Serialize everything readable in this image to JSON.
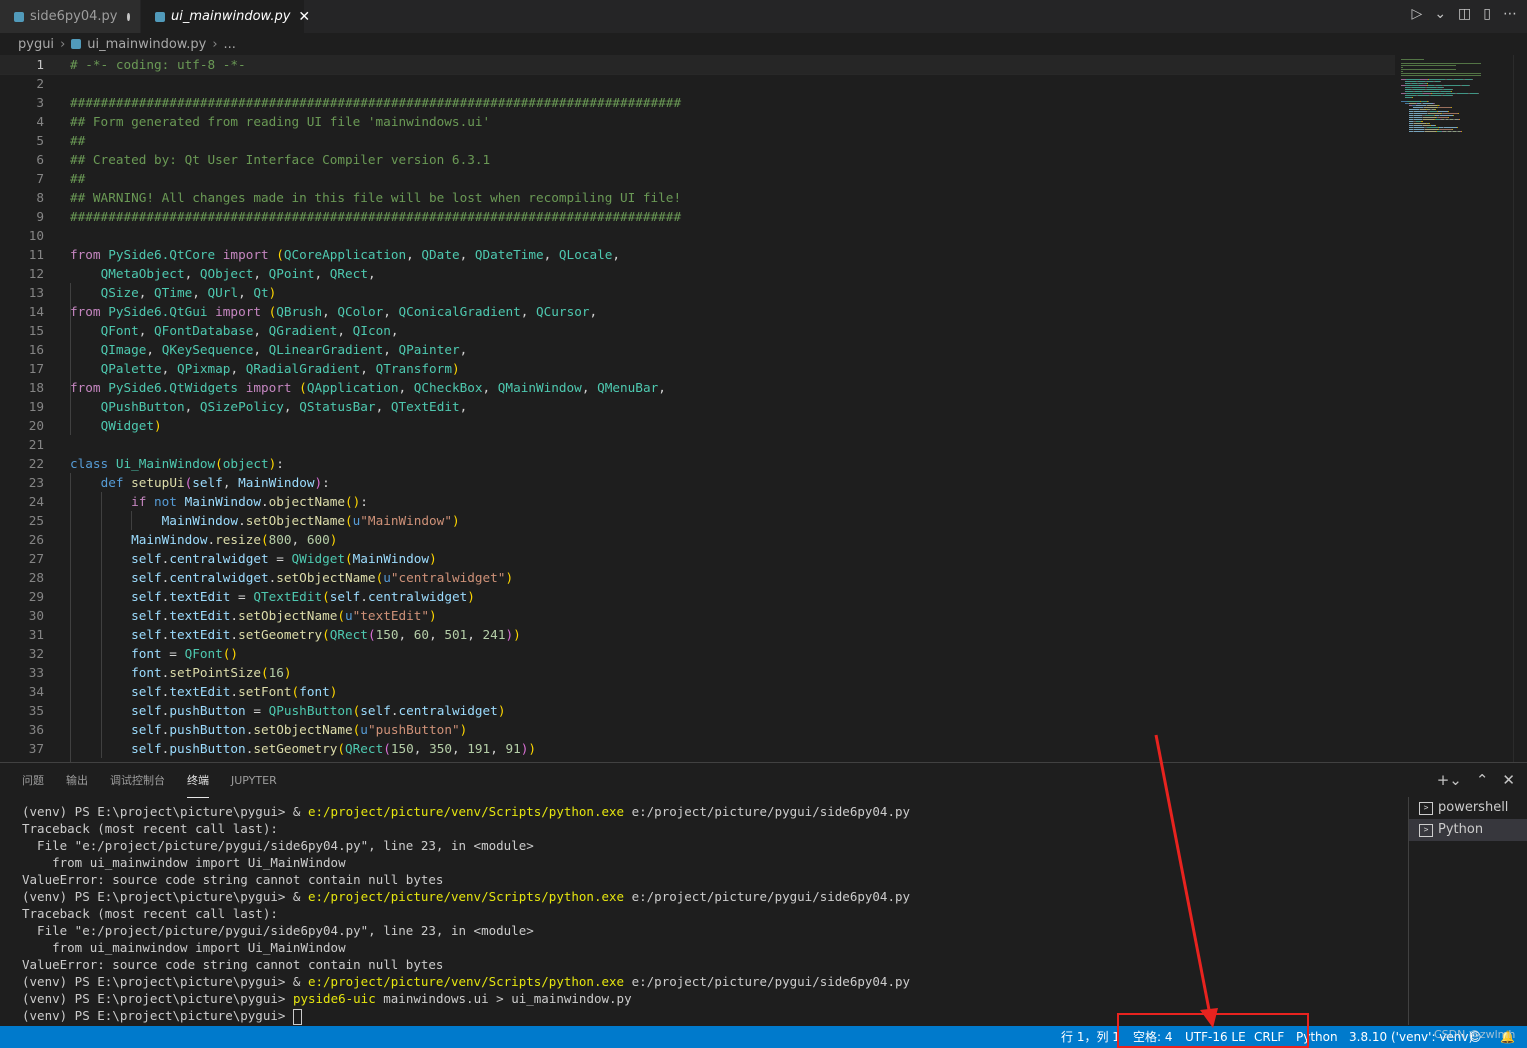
{
  "tabs": [
    {
      "label": "side6py04.py",
      "modified": true
    },
    {
      "label": "ui_mainwindow.py",
      "close": "✕"
    }
  ],
  "breadcrumb": [
    "pygui",
    "ui_mainwindow.py",
    "..."
  ],
  "code": [
    [
      [
        "c",
        "# -*- coding: utf-8 -*-"
      ]
    ],
    [],
    [
      [
        "c",
        "################################################################################"
      ]
    ],
    [
      [
        "c",
        "## Form generated from reading UI file 'mainwindows.ui'"
      ]
    ],
    [
      [
        "c",
        "##"
      ]
    ],
    [
      [
        "c",
        "## Created by: Qt User Interface Compiler version 6.3.1"
      ]
    ],
    [
      [
        "c",
        "##"
      ]
    ],
    [
      [
        "c",
        "## WARNING! All changes made in this file will be lost when recompiling UI file!"
      ]
    ],
    [
      [
        "c",
        "################################################################################"
      ]
    ],
    [],
    [
      [
        "kf",
        "from "
      ],
      [
        "t",
        "PySide6.QtCore"
      ],
      [
        "kf",
        " import "
      ],
      [
        "b",
        "("
      ],
      [
        "t",
        "QCoreApplication"
      ],
      [
        "p",
        ", "
      ],
      [
        "t",
        "QDate"
      ],
      [
        "p",
        ", "
      ],
      [
        "t",
        "QDateTime"
      ],
      [
        "p",
        ", "
      ],
      [
        "t",
        "QLocale"
      ],
      [
        "p",
        ","
      ]
    ],
    [
      [
        "p",
        "    "
      ],
      [
        "t",
        "QMetaObject"
      ],
      [
        "p",
        ", "
      ],
      [
        "t",
        "QObject"
      ],
      [
        "p",
        ", "
      ],
      [
        "t",
        "QPoint"
      ],
      [
        "p",
        ", "
      ],
      [
        "t",
        "QRect"
      ],
      [
        "p",
        ","
      ]
    ],
    [
      [
        "p",
        "    "
      ],
      [
        "t",
        "QSize"
      ],
      [
        "p",
        ", "
      ],
      [
        "t",
        "QTime"
      ],
      [
        "p",
        ", "
      ],
      [
        "t",
        "QUrl"
      ],
      [
        "p",
        ", "
      ],
      [
        "t",
        "Qt"
      ],
      [
        "b",
        ")"
      ]
    ],
    [
      [
        "kf",
        "from "
      ],
      [
        "t",
        "PySide6.QtGui"
      ],
      [
        "kf",
        " import "
      ],
      [
        "b",
        "("
      ],
      [
        "t",
        "QBrush"
      ],
      [
        "p",
        ", "
      ],
      [
        "t",
        "QColor"
      ],
      [
        "p",
        ", "
      ],
      [
        "t",
        "QConicalGradient"
      ],
      [
        "p",
        ", "
      ],
      [
        "t",
        "QCursor"
      ],
      [
        "p",
        ","
      ]
    ],
    [
      [
        "p",
        "    "
      ],
      [
        "t",
        "QFont"
      ],
      [
        "p",
        ", "
      ],
      [
        "t",
        "QFontDatabase"
      ],
      [
        "p",
        ", "
      ],
      [
        "t",
        "QGradient"
      ],
      [
        "p",
        ", "
      ],
      [
        "t",
        "QIcon"
      ],
      [
        "p",
        ","
      ]
    ],
    [
      [
        "p",
        "    "
      ],
      [
        "t",
        "QImage"
      ],
      [
        "p",
        ", "
      ],
      [
        "t",
        "QKeySequence"
      ],
      [
        "p",
        ", "
      ],
      [
        "t",
        "QLinearGradient"
      ],
      [
        "p",
        ", "
      ],
      [
        "t",
        "QPainter"
      ],
      [
        "p",
        ","
      ]
    ],
    [
      [
        "p",
        "    "
      ],
      [
        "t",
        "QPalette"
      ],
      [
        "p",
        ", "
      ],
      [
        "t",
        "QPixmap"
      ],
      [
        "p",
        ", "
      ],
      [
        "t",
        "QRadialGradient"
      ],
      [
        "p",
        ", "
      ],
      [
        "t",
        "QTransform"
      ],
      [
        "b",
        ")"
      ]
    ],
    [
      [
        "kf",
        "from "
      ],
      [
        "t",
        "PySide6.QtWidgets"
      ],
      [
        "kf",
        " import "
      ],
      [
        "b",
        "("
      ],
      [
        "t",
        "QApplication"
      ],
      [
        "p",
        ", "
      ],
      [
        "t",
        "QCheckBox"
      ],
      [
        "p",
        ", "
      ],
      [
        "t",
        "QMainWindow"
      ],
      [
        "p",
        ", "
      ],
      [
        "t",
        "QMenuBar"
      ],
      [
        "p",
        ","
      ]
    ],
    [
      [
        "p",
        "    "
      ],
      [
        "t",
        "QPushButton"
      ],
      [
        "p",
        ", "
      ],
      [
        "t",
        "QSizePolicy"
      ],
      [
        "p",
        ", "
      ],
      [
        "t",
        "QStatusBar"
      ],
      [
        "p",
        ", "
      ],
      [
        "t",
        "QTextEdit"
      ],
      [
        "p",
        ","
      ]
    ],
    [
      [
        "p",
        "    "
      ],
      [
        "t",
        "QWidget"
      ],
      [
        "b",
        ")"
      ]
    ],
    [],
    [
      [
        "k",
        "class "
      ],
      [
        "t",
        "Ui_MainWindow"
      ],
      [
        "b",
        "("
      ],
      [
        "t",
        "object"
      ],
      [
        "b",
        ")"
      ],
      [
        "p",
        ":"
      ]
    ],
    [
      [
        "p",
        "    "
      ],
      [
        "k",
        "def "
      ],
      [
        "f",
        "setupUi"
      ],
      [
        "b2",
        "("
      ],
      [
        "v",
        "self"
      ],
      [
        "p",
        ", "
      ],
      [
        "v",
        "MainWindow"
      ],
      [
        "b2",
        ")"
      ],
      [
        "p",
        ":"
      ]
    ],
    [
      [
        "p",
        "        "
      ],
      [
        "kf",
        "if "
      ],
      [
        "k",
        "not "
      ],
      [
        "v",
        "MainWindow"
      ],
      [
        "p",
        "."
      ],
      [
        "f",
        "objectName"
      ],
      [
        "b",
        "()"
      ],
      [
        "p",
        ":"
      ]
    ],
    [
      [
        "p",
        "            "
      ],
      [
        "v",
        "MainWindow"
      ],
      [
        "p",
        "."
      ],
      [
        "f",
        "setObjectName"
      ],
      [
        "b",
        "("
      ],
      [
        "k",
        "u"
      ],
      [
        "s",
        "\"MainWindow\""
      ],
      [
        "b",
        ")"
      ]
    ],
    [
      [
        "p",
        "        "
      ],
      [
        "v",
        "MainWindow"
      ],
      [
        "p",
        "."
      ],
      [
        "f",
        "resize"
      ],
      [
        "b",
        "("
      ],
      [
        "n",
        "800"
      ],
      [
        "p",
        ", "
      ],
      [
        "n",
        "600"
      ],
      [
        "b",
        ")"
      ]
    ],
    [
      [
        "p",
        "        "
      ],
      [
        "v",
        "self"
      ],
      [
        "p",
        "."
      ],
      [
        "v",
        "centralwidget"
      ],
      [
        "p",
        " = "
      ],
      [
        "t",
        "QWidget"
      ],
      [
        "b",
        "("
      ],
      [
        "v",
        "MainWindow"
      ],
      [
        "b",
        ")"
      ]
    ],
    [
      [
        "p",
        "        "
      ],
      [
        "v",
        "self"
      ],
      [
        "p",
        "."
      ],
      [
        "v",
        "centralwidget"
      ],
      [
        "p",
        "."
      ],
      [
        "f",
        "setObjectName"
      ],
      [
        "b",
        "("
      ],
      [
        "k",
        "u"
      ],
      [
        "s",
        "\"centralwidget\""
      ],
      [
        "b",
        ")"
      ]
    ],
    [
      [
        "p",
        "        "
      ],
      [
        "v",
        "self"
      ],
      [
        "p",
        "."
      ],
      [
        "v",
        "textEdit"
      ],
      [
        "p",
        " = "
      ],
      [
        "t",
        "QTextEdit"
      ],
      [
        "b",
        "("
      ],
      [
        "v",
        "self"
      ],
      [
        "p",
        "."
      ],
      [
        "v",
        "centralwidget"
      ],
      [
        "b",
        ")"
      ]
    ],
    [
      [
        "p",
        "        "
      ],
      [
        "v",
        "self"
      ],
      [
        "p",
        "."
      ],
      [
        "v",
        "textEdit"
      ],
      [
        "p",
        "."
      ],
      [
        "f",
        "setObjectName"
      ],
      [
        "b",
        "("
      ],
      [
        "k",
        "u"
      ],
      [
        "s",
        "\"textEdit\""
      ],
      [
        "b",
        ")"
      ]
    ],
    [
      [
        "p",
        "        "
      ],
      [
        "v",
        "self"
      ],
      [
        "p",
        "."
      ],
      [
        "v",
        "textEdit"
      ],
      [
        "p",
        "."
      ],
      [
        "f",
        "setGeometry"
      ],
      [
        "b",
        "("
      ],
      [
        "t",
        "QRect"
      ],
      [
        "b2",
        "("
      ],
      [
        "n",
        "150"
      ],
      [
        "p",
        ", "
      ],
      [
        "n",
        "60"
      ],
      [
        "p",
        ", "
      ],
      [
        "n",
        "501"
      ],
      [
        "p",
        ", "
      ],
      [
        "n",
        "241"
      ],
      [
        "b2",
        ")"
      ],
      [
        "b",
        ")"
      ]
    ],
    [
      [
        "p",
        "        "
      ],
      [
        "v",
        "font"
      ],
      [
        "p",
        " = "
      ],
      [
        "t",
        "QFont"
      ],
      [
        "b",
        "()"
      ]
    ],
    [
      [
        "p",
        "        "
      ],
      [
        "v",
        "font"
      ],
      [
        "p",
        "."
      ],
      [
        "f",
        "setPointSize"
      ],
      [
        "b",
        "("
      ],
      [
        "n",
        "16"
      ],
      [
        "b",
        ")"
      ]
    ],
    [
      [
        "p",
        "        "
      ],
      [
        "v",
        "self"
      ],
      [
        "p",
        "."
      ],
      [
        "v",
        "textEdit"
      ],
      [
        "p",
        "."
      ],
      [
        "f",
        "setFont"
      ],
      [
        "b",
        "("
      ],
      [
        "v",
        "font"
      ],
      [
        "b",
        ")"
      ]
    ],
    [
      [
        "p",
        "        "
      ],
      [
        "v",
        "self"
      ],
      [
        "p",
        "."
      ],
      [
        "v",
        "pushButton"
      ],
      [
        "p",
        " = "
      ],
      [
        "t",
        "QPushButton"
      ],
      [
        "b",
        "("
      ],
      [
        "v",
        "self"
      ],
      [
        "p",
        "."
      ],
      [
        "v",
        "centralwidget"
      ],
      [
        "b",
        ")"
      ]
    ],
    [
      [
        "p",
        "        "
      ],
      [
        "v",
        "self"
      ],
      [
        "p",
        "."
      ],
      [
        "v",
        "pushButton"
      ],
      [
        "p",
        "."
      ],
      [
        "f",
        "setObjectName"
      ],
      [
        "b",
        "("
      ],
      [
        "k",
        "u"
      ],
      [
        "s",
        "\"pushButton\""
      ],
      [
        "b",
        ")"
      ]
    ],
    [
      [
        "p",
        "        "
      ],
      [
        "v",
        "self"
      ],
      [
        "p",
        "."
      ],
      [
        "v",
        "pushButton"
      ],
      [
        "p",
        "."
      ],
      [
        "f",
        "setGeometry"
      ],
      [
        "b",
        "("
      ],
      [
        "t",
        "QRect"
      ],
      [
        "b2",
        "("
      ],
      [
        "n",
        "150"
      ],
      [
        "p",
        ", "
      ],
      [
        "n",
        "350"
      ],
      [
        "p",
        ", "
      ],
      [
        "n",
        "191"
      ],
      [
        "p",
        ", "
      ],
      [
        "n",
        "91"
      ],
      [
        "b2",
        ")"
      ],
      [
        "b",
        ")"
      ]
    ]
  ],
  "panel": {
    "tabs": [
      "问题",
      "输出",
      "调试控制台",
      "终端",
      "JUPYTER"
    ],
    "active_tab": "终端"
  },
  "terminal_lines": [
    [
      [
        "p",
        "(venv) PS E:\\project\\picture\\pygui> & "
      ],
      [
        "y",
        "e:/project/picture/venv/Scripts/python.exe"
      ],
      [
        "p",
        " e:/project/picture/pygui/side6py04.py"
      ]
    ],
    [
      [
        "p",
        "Traceback (most recent call last):"
      ]
    ],
    [
      [
        "p",
        "  File \"e:/project/picture/pygui/side6py04.py\", line 23, in <module>"
      ]
    ],
    [
      [
        "p",
        "    from ui_mainwindow import Ui_MainWindow"
      ]
    ],
    [
      [
        "p",
        "ValueError: source code string cannot contain null bytes"
      ]
    ],
    [
      [
        "p",
        "(venv) PS E:\\project\\picture\\pygui> & "
      ],
      [
        "y",
        "e:/project/picture/venv/Scripts/python.exe"
      ],
      [
        "p",
        " e:/project/picture/pygui/side6py04.py"
      ]
    ],
    [
      [
        "p",
        "Traceback (most recent call last):"
      ]
    ],
    [
      [
        "p",
        "  File \"e:/project/picture/pygui/side6py04.py\", line 23, in <module>"
      ]
    ],
    [
      [
        "p",
        "    from ui_mainwindow import Ui_MainWindow"
      ]
    ],
    [
      [
        "p",
        "ValueError: source code string cannot contain null bytes"
      ]
    ],
    [
      [
        "p",
        "(venv) PS E:\\project\\picture\\pygui> & "
      ],
      [
        "y",
        "e:/project/picture/venv/Scripts/python.exe"
      ],
      [
        "p",
        " e:/project/picture/pygui/side6py04.py"
      ]
    ],
    [
      [
        "p",
        "(venv) PS E:\\project\\picture\\pygui> "
      ],
      [
        "y",
        "pyside6-uic"
      ],
      [
        "p",
        " mainwindows.ui > ui_mainwindow.py"
      ]
    ],
    [
      [
        "p",
        "(venv) PS E:\\project\\picture\\pygui> "
      ]
    ]
  ],
  "terminal_list": [
    "powershell",
    "Python"
  ],
  "status": {
    "position": "行 1，列 1",
    "indent": "空格: 4",
    "encoding": "UTF-16 LE",
    "eol": "CRLF",
    "language": "Python",
    "interpreter": "3.8.10 ('venv': venv)"
  },
  "watermark": "CSDN @zwlmh",
  "colors": {
    "statusbar": "#007acc",
    "annotation": "#e8231f"
  }
}
